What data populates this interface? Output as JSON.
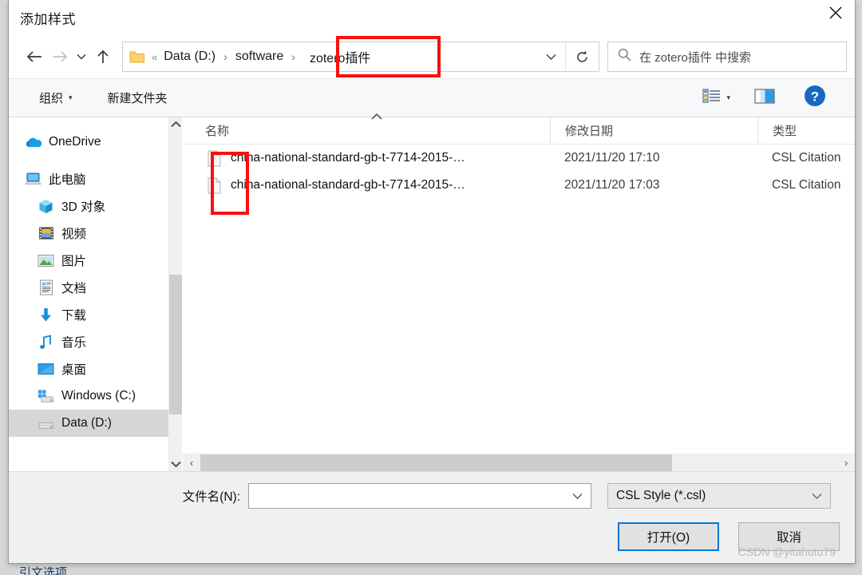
{
  "window": {
    "title": "添加样式",
    "close_icon": "close-icon"
  },
  "nav": {
    "back_icon": "arrow-left-icon",
    "forward_icon": "arrow-right-icon",
    "recent_icon": "chevron-down-icon",
    "up_icon": "arrow-up-icon"
  },
  "address": {
    "folder_icon": "folder-icon",
    "prefix": "«",
    "crumbs": [
      "Data (D:)",
      "software",
      "zotero插件"
    ],
    "separator": "›",
    "dropdown_icon": "chevron-down-icon",
    "refresh_icon": "refresh-icon"
  },
  "search": {
    "icon": "search-icon",
    "placeholder": "在 zotero插件 中搜索"
  },
  "toolbar": {
    "organize_label": "组织",
    "organize_caret": "▾",
    "new_folder_label": "新建文件夹",
    "view_icon": "list-view-icon",
    "view_caret": "▾",
    "preview_pane_icon": "preview-pane-icon",
    "help_icon": "help-icon",
    "help_glyph": "?"
  },
  "sidebar": {
    "items": [
      {
        "label": "OneDrive",
        "icon": "onedrive-cloud-icon",
        "indent": 0,
        "selected": false
      },
      {
        "label": "此电脑",
        "icon": "this-pc-icon",
        "indent": 0,
        "selected": false
      },
      {
        "label": "3D 对象",
        "icon": "3d-objects-icon",
        "indent": 1,
        "selected": false
      },
      {
        "label": "视频",
        "icon": "videos-icon",
        "indent": 1,
        "selected": false
      },
      {
        "label": "图片",
        "icon": "pictures-icon",
        "indent": 1,
        "selected": false
      },
      {
        "label": "文档",
        "icon": "documents-icon",
        "indent": 1,
        "selected": false
      },
      {
        "label": "下载",
        "icon": "downloads-icon",
        "indent": 1,
        "selected": false
      },
      {
        "label": "音乐",
        "icon": "music-icon",
        "indent": 1,
        "selected": false
      },
      {
        "label": "桌面",
        "icon": "desktop-icon",
        "indent": 1,
        "selected": false
      },
      {
        "label": "Windows (C:)",
        "icon": "windows-drive-icon",
        "indent": 1,
        "selected": false
      },
      {
        "label": "Data (D:)",
        "icon": "hard-drive-icon",
        "indent": 1,
        "selected": true
      }
    ],
    "scroll_up_icon": "chevron-up-icon",
    "scroll_down_icon": "chevron-down-icon"
  },
  "filelist": {
    "columns": [
      "名称",
      "修改日期",
      "类型"
    ],
    "sort_indicator": "▲",
    "rows": [
      {
        "icon": "file-icon",
        "name": "china-national-standard-gb-t-7714-2015-…",
        "date": "2021/11/20 17:10",
        "type": "CSL Citation"
      },
      {
        "icon": "file-icon",
        "name": "china-national-standard-gb-t-7714-2015-…",
        "date": "2021/11/20 17:03",
        "type": "CSL Citation"
      }
    ],
    "hscroll_left_icon": "chevron-left-icon",
    "hscroll_right_icon": "chevron-right-icon"
  },
  "footer": {
    "filename_label": "文件名(N):",
    "filename_value": "",
    "filename_caret_icon": "chevron-down-icon",
    "filetype_value": "CSL Style (*.csl)",
    "filetype_caret_icon": "chevron-down-icon",
    "open_button": "打开(O)",
    "cancel_button": "取消",
    "watermark": "CSDN @yitahutu79"
  },
  "background": {
    "partial_text": "引文选项"
  },
  "annotations": {
    "accent_color": "#fb0f0f",
    "path_box_target": "zotero插件",
    "icons_box_target": "file-icons-column"
  }
}
